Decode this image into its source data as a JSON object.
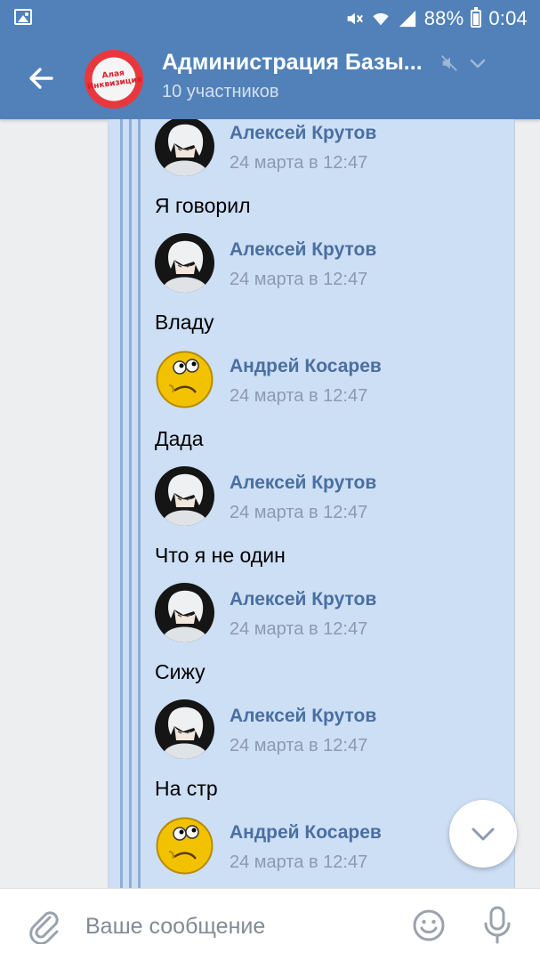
{
  "status_bar": {
    "battery_percent": "88%",
    "time": "0:04",
    "icons": [
      "gallery-icon",
      "mute-icon",
      "wifi-icon",
      "signal-icon",
      "battery-icon"
    ]
  },
  "header": {
    "title": "Администрация Базы...",
    "subtitle": "10 участников",
    "avatar_logo_text": "Алая Инквизиция",
    "icons": [
      "back-arrow-icon",
      "mute-icon",
      "chevron-down-icon"
    ]
  },
  "messages": [
    {
      "author": "Алексей Крутов",
      "date": "24 марта в 12:47",
      "text": "Я говорил",
      "avatar": "anime-avatar"
    },
    {
      "author": "Алексей Крутов",
      "date": "24 марта в 12:47",
      "text": "Владу",
      "avatar": "anime-avatar"
    },
    {
      "author": "Андрей Косарев",
      "date": "24 марта в 12:47",
      "text": "Дада",
      "avatar": "smiley-avatar"
    },
    {
      "author": "Алексей Крутов",
      "date": "24 марта в 12:47",
      "text": "Что я не один",
      "avatar": "anime-avatar"
    },
    {
      "author": "Алексей Крутов",
      "date": "24 марта в 12:47",
      "text": "Сижу",
      "avatar": "anime-avatar"
    },
    {
      "author": "Алексей Крутов",
      "date": "24 марта в 12:47",
      "text": "На стр",
      "avatar": "anime-avatar"
    },
    {
      "author": "Андрей Косарев",
      "date": "24 марта в 12:47",
      "text": "",
      "avatar": "smiley-avatar"
    }
  ],
  "composer": {
    "placeholder": "Ваше сообщение",
    "value": ""
  },
  "colors": {
    "header_blue": "#5181b8",
    "forward_background": "#cddff5",
    "author_blue": "#4a6fa0",
    "date_gray": "#8a9bb1"
  }
}
